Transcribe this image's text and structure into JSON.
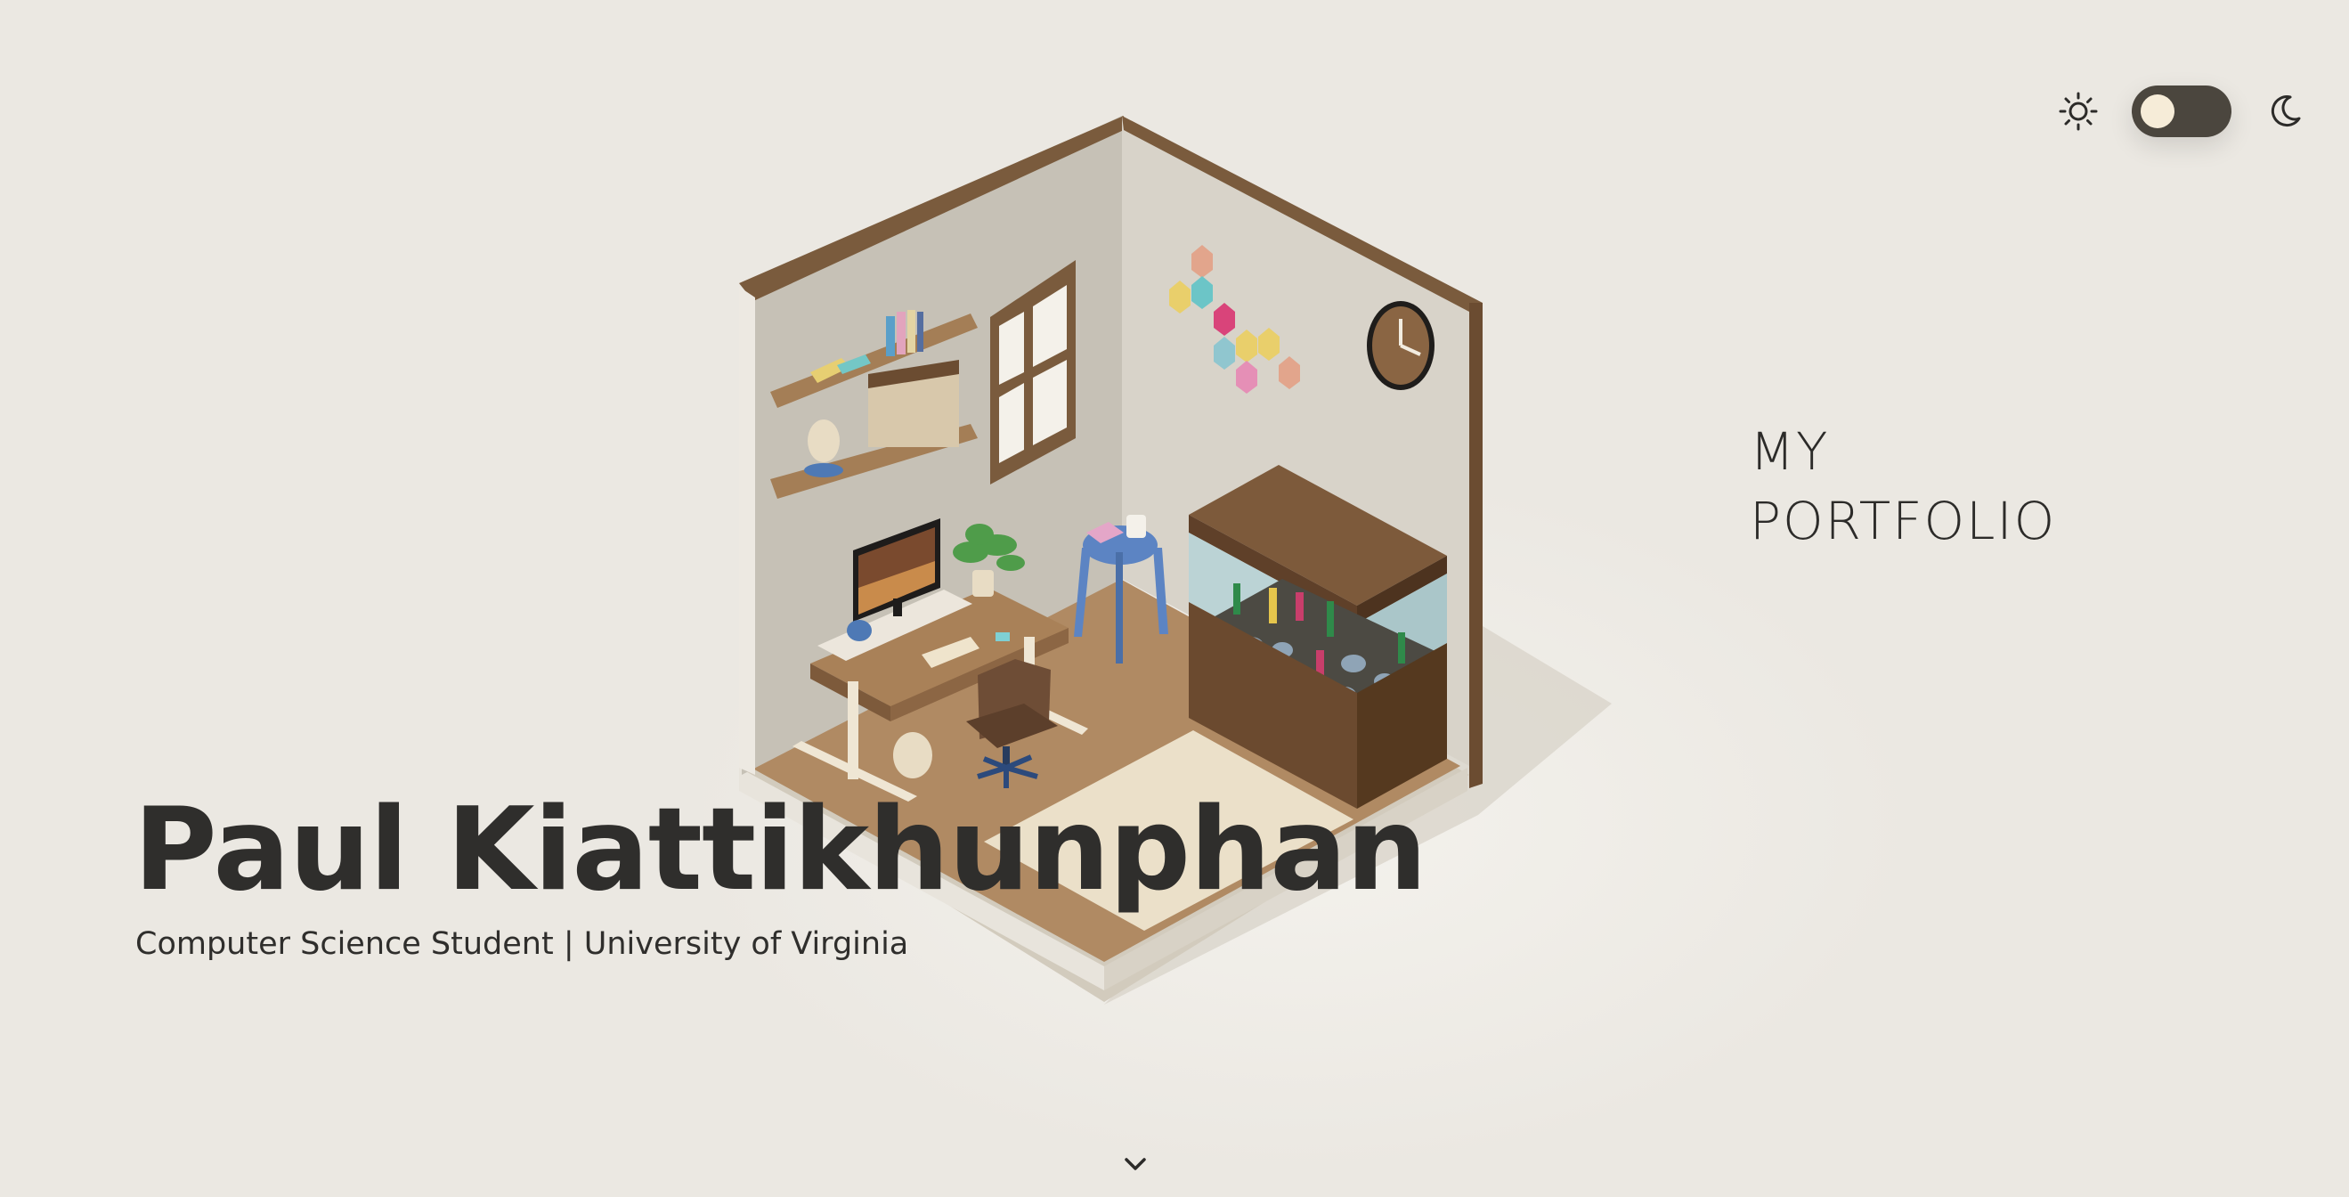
{
  "hero": {
    "name": "Paul Kiattikhunphan",
    "subtitle": "Computer Science Student | University of Virginia"
  },
  "portfolio": {
    "line1": "MY",
    "line2": "PORTFOLIO"
  },
  "theme_toggle": {
    "light_icon": "sun-icon",
    "dark_icon": "moon-icon",
    "state": "light"
  },
  "scroll": {
    "icon": "chevron-down-icon"
  },
  "colors": {
    "background": "#ebe8e2",
    "text": "#2c2b29",
    "toggle_track": "#4b463e",
    "toggle_knob": "#f6ecd8"
  }
}
